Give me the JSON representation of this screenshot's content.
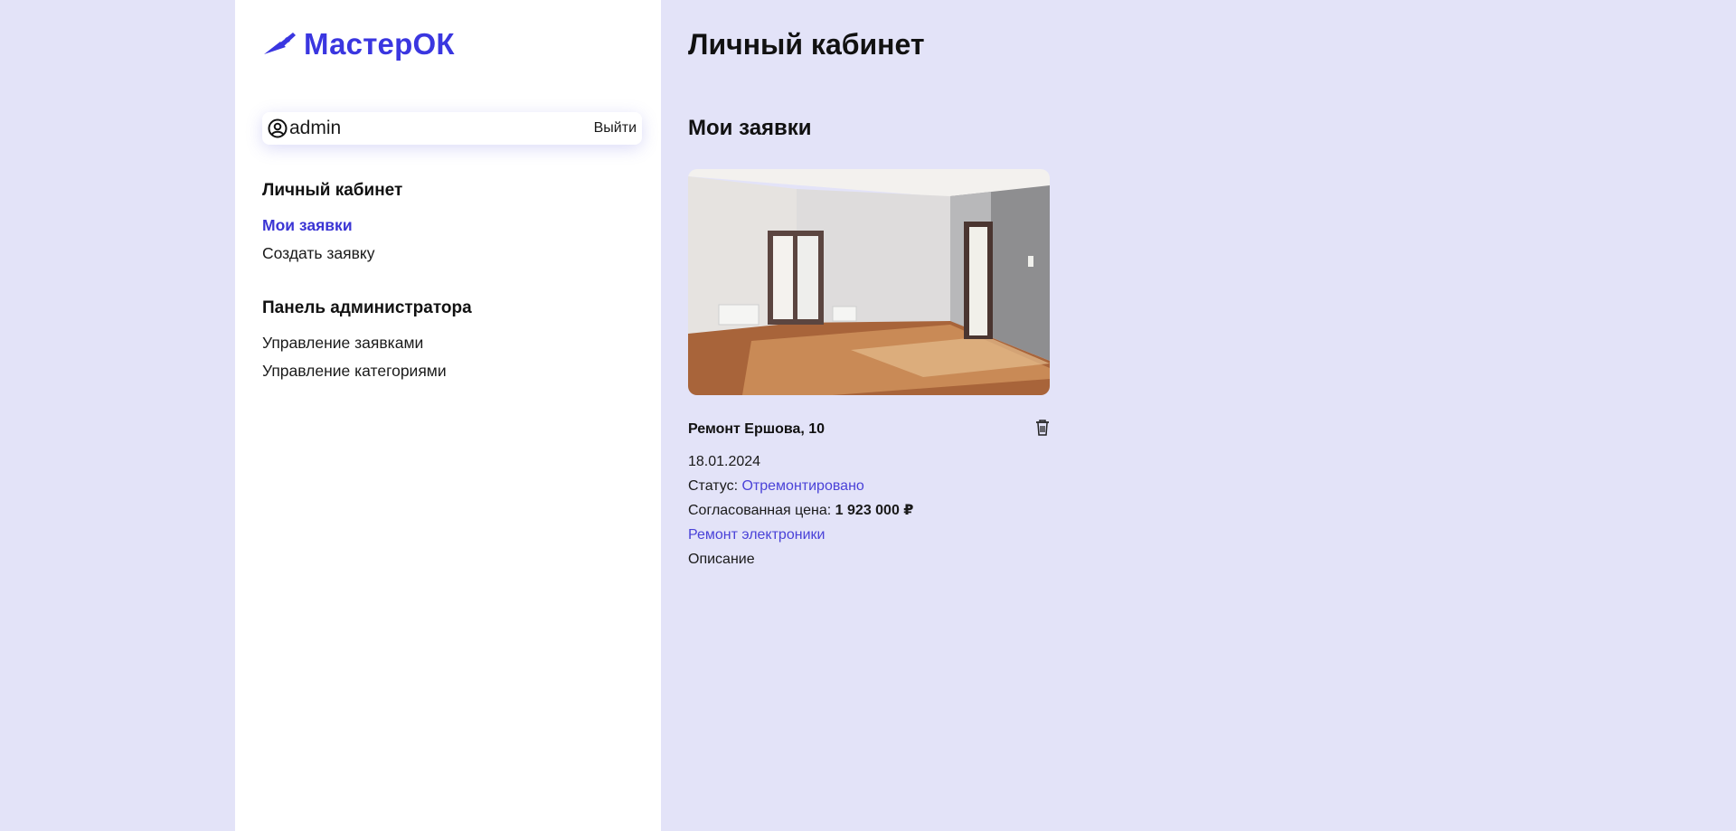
{
  "brand": {
    "name": "МастерОК",
    "color": "#3a36e0",
    "icon": "trowel-icon"
  },
  "user": {
    "icon": "user-circle-icon",
    "name": "admin",
    "logout_label": "Выйти"
  },
  "sidebar": {
    "sections": [
      {
        "heading": "Личный кабинет",
        "items": [
          {
            "label": "Мои заявки",
            "active": true
          },
          {
            "label": "Создать заявку",
            "active": false
          }
        ]
      },
      {
        "heading": "Панель администратора",
        "items": [
          {
            "label": "Управление заявками",
            "active": false
          },
          {
            "label": "Управление категориями",
            "active": false
          }
        ]
      }
    ]
  },
  "main": {
    "page_title": "Личный кабинет",
    "section_title": "Мои заявки",
    "requests": [
      {
        "title": "Ремонт Ершова, 10",
        "date": "18.01.2024",
        "status_label": "Статус:",
        "status": "Отремонтировано",
        "price_label": "Согласованная цена:",
        "price": "1 923 000 ₽",
        "category": "Ремонт электроники",
        "description": "Описание",
        "delete_icon": "trash-icon"
      }
    ]
  },
  "colors": {
    "background": "#e3e3f8",
    "sidebar": "#ffffff",
    "accent": "#4a42d8",
    "active_link": "#3b35d4"
  }
}
